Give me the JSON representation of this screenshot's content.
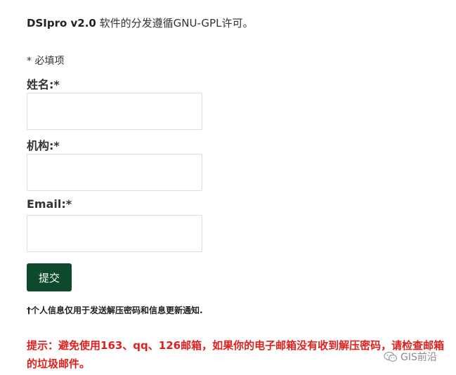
{
  "intro": {
    "product": "DSIpro v2.0",
    "text": " 软件的分发遵循GNU-GPL许可。"
  },
  "form": {
    "required_note": "* 必填项",
    "fields": [
      {
        "label": "姓名:*",
        "value": ""
      },
      {
        "label": "机构:*",
        "value": ""
      },
      {
        "label": "Email:*",
        "value": ""
      }
    ],
    "submit_label": "提交"
  },
  "privacy_note": "†个人信息仅用于发送解压密码和信息更新通知.",
  "warning": "提示：避免使用163、qq、126邮箱，如果你的电子邮箱没有收到解压密码，请检查邮箱的垃圾邮件。",
  "watermark": {
    "text": "GIS前沿",
    "icon": "wechat-icon"
  }
}
